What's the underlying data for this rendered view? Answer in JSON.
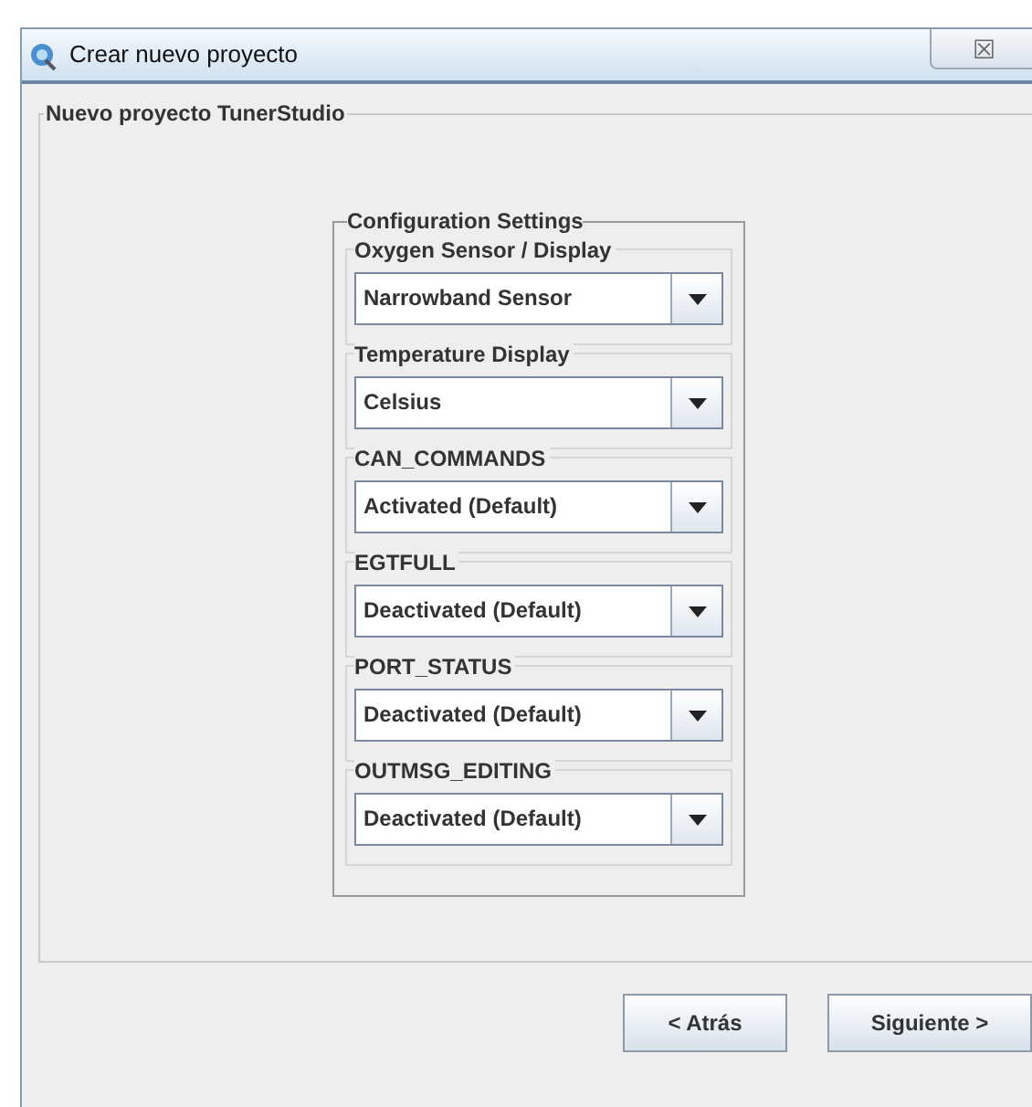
{
  "window": {
    "title": "Crear nuevo proyecto",
    "close_glyph": "☒"
  },
  "group_title": "Nuevo proyecto TunerStudio",
  "settings": {
    "title": "Configuration Settings",
    "fields": [
      {
        "label": "Oxygen Sensor / Display",
        "value": "Narrowband Sensor"
      },
      {
        "label": "Temperature Display",
        "value": "Celsius"
      },
      {
        "label": "CAN_COMMANDS",
        "value": "Activated (Default)"
      },
      {
        "label": "EGTFULL",
        "value": "Deactivated (Default)"
      },
      {
        "label": "PORT_STATUS",
        "value": "Deactivated (Default)"
      },
      {
        "label": "OUTMSG_EDITING",
        "value": "Deactivated (Default)"
      }
    ]
  },
  "buttons": [
    "< Atrás",
    "Siguiente >"
  ]
}
